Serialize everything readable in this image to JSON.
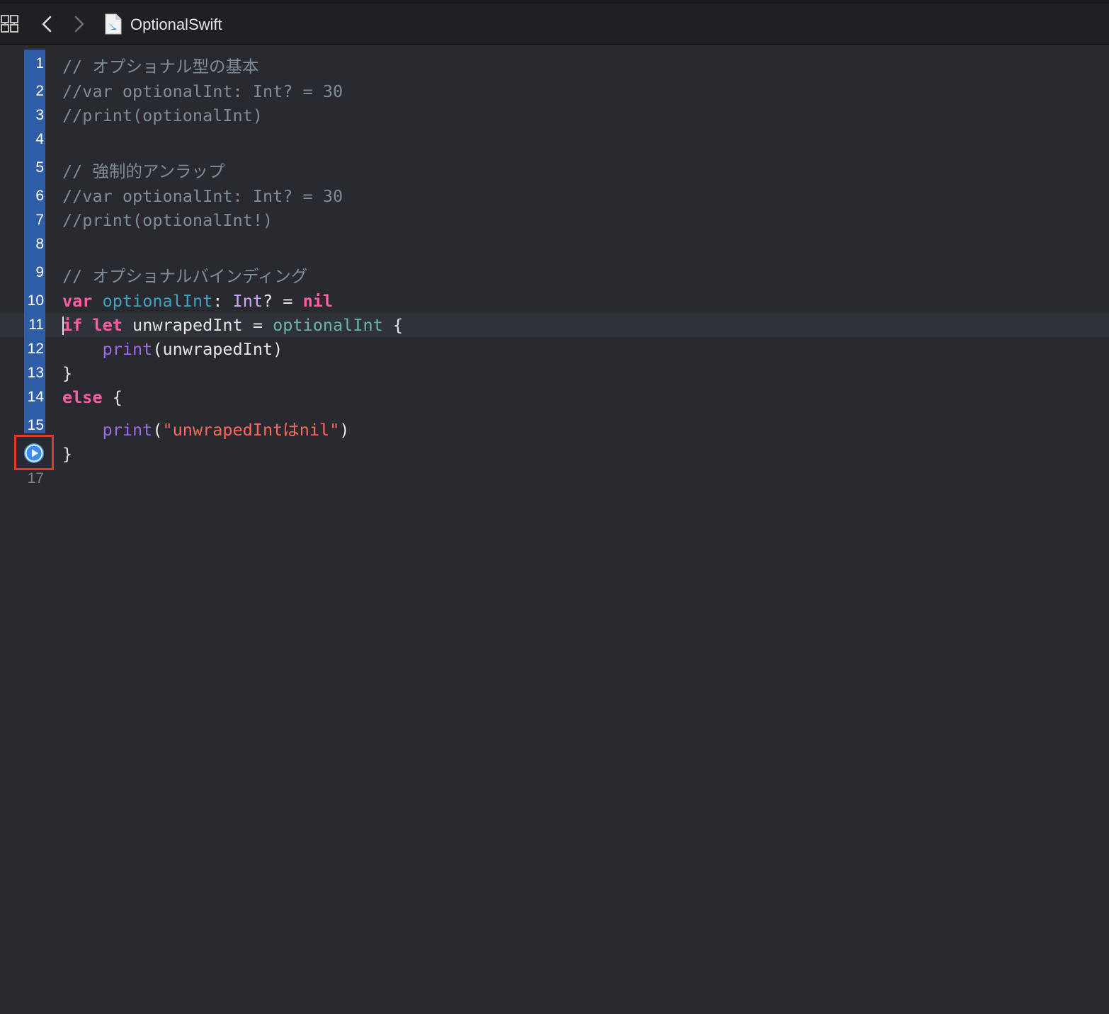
{
  "toolbar": {
    "file_title": "OptionalSwift",
    "icons": [
      "editor-grid-icon",
      "chevron-left-icon",
      "chevron-right-icon",
      "swift-file-icon"
    ]
  },
  "editor": {
    "current_line": 11,
    "gutter": {
      "line_numbers": [
        "1",
        "2",
        "3",
        "4",
        "5",
        "6",
        "7",
        "8",
        "9",
        "10",
        "11",
        "12",
        "13",
        "14",
        "15",
        "17"
      ],
      "run_button_line": 16,
      "run_button_icon": "play-circle-icon"
    },
    "lines": [
      {
        "n": 1,
        "tokens": [
          {
            "t": "// オプショナル型の基本",
            "k": "comment"
          }
        ]
      },
      {
        "n": 2,
        "tokens": [
          {
            "t": "//var optionalInt: Int? = 30",
            "k": "comment"
          }
        ]
      },
      {
        "n": 3,
        "tokens": [
          {
            "t": "//print(optionalInt)",
            "k": "comment"
          }
        ]
      },
      {
        "n": 4,
        "tokens": []
      },
      {
        "n": 5,
        "tokens": [
          {
            "t": "// 強制的アンラップ",
            "k": "comment"
          }
        ]
      },
      {
        "n": 6,
        "tokens": [
          {
            "t": "//var optionalInt: Int? = 30",
            "k": "comment"
          }
        ]
      },
      {
        "n": 7,
        "tokens": [
          {
            "t": "//print(optionalInt!)",
            "k": "comment"
          }
        ]
      },
      {
        "n": 8,
        "tokens": []
      },
      {
        "n": 9,
        "tokens": [
          {
            "t": "// オプショナルバインディング",
            "k": "comment"
          }
        ]
      },
      {
        "n": 10,
        "tokens": [
          {
            "t": "var",
            "k": "kw"
          },
          {
            "t": " ",
            "k": "plain"
          },
          {
            "t": "optionalInt",
            "k": "decl"
          },
          {
            "t": ": ",
            "k": "plain"
          },
          {
            "t": "Int",
            "k": "type"
          },
          {
            "t": "? = ",
            "k": "plain"
          },
          {
            "t": "nil",
            "k": "kw"
          }
        ]
      },
      {
        "n": 11,
        "tokens": [
          {
            "t": "if",
            "k": "kw"
          },
          {
            "t": " ",
            "k": "plain"
          },
          {
            "t": "let",
            "k": "kw"
          },
          {
            "t": " unwrapedInt = ",
            "k": "plain"
          },
          {
            "t": "optionalInt",
            "k": "var"
          },
          {
            "t": " {",
            "k": "plain"
          }
        ]
      },
      {
        "n": 12,
        "tokens": [
          {
            "t": "    ",
            "k": "plain"
          },
          {
            "t": "print",
            "k": "fn"
          },
          {
            "t": "(unwrapedInt)",
            "k": "plain"
          }
        ]
      },
      {
        "n": 13,
        "tokens": [
          {
            "t": "}",
            "k": "plain"
          }
        ]
      },
      {
        "n": 14,
        "tokens": [
          {
            "t": "else",
            "k": "kw"
          },
          {
            "t": " {",
            "k": "plain"
          }
        ]
      },
      {
        "n": 15,
        "tokens": [
          {
            "t": "    ",
            "k": "plain"
          },
          {
            "t": "print",
            "k": "fn"
          },
          {
            "t": "(",
            "k": "plain"
          },
          {
            "t": "\"unwrapedIntはnil\"",
            "k": "str"
          },
          {
            "t": ")",
            "k": "plain"
          }
        ]
      },
      {
        "n": 16,
        "tokens": [
          {
            "t": "}",
            "k": "plain"
          }
        ]
      },
      {
        "n": 17,
        "tokens": []
      }
    ]
  },
  "colors": {
    "background": "#292a30",
    "gutter_highlight": "#2f5da7",
    "run_button": "#3b8eea",
    "annotation_box": "#e0392a",
    "keyword": "#fc5fa3",
    "comment": "#7f8c98",
    "string": "#fc6a5d"
  }
}
